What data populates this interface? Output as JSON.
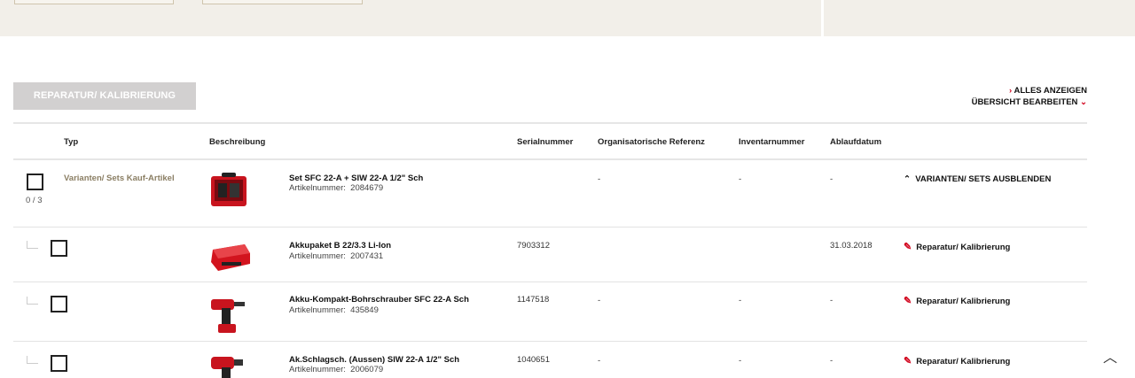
{
  "header": {
    "repair_button": "REPARATUR/ KALIBRIERUNG"
  },
  "links": {
    "show_all": "ALLES ANZEIGEN",
    "edit_overview": "ÜBERSICHT BEARBEITEN",
    "show_all_icon": "chevron-right-icon",
    "edit_icon": "chevron-down-icon"
  },
  "table": {
    "columns": [
      "Typ",
      "Beschreibung",
      "Serialnummer",
      "Organisatorische Referenz",
      "Inventarnummer",
      "Ablaufdatum"
    ],
    "set_row": {
      "type": "Varianten/ Sets Kauf-Artikel",
      "count": "0 / 3",
      "title": "Set SFC 22-A + SIW 22-A 1/2\" Sch",
      "article_label": "Artikelnummer:",
      "article_no": "2084679",
      "serial": "",
      "org_ref": "-",
      "inventory": "-",
      "expiry": "-",
      "action": "VARIANTEN/ SETS AUSBLENDEN"
    },
    "rows": [
      {
        "title": "Akkupaket B 22/3.3 Li-Ion",
        "article_label": "Artikelnummer:",
        "article_no": "2007431",
        "serial": "7903312",
        "org_ref": "",
        "inventory": "",
        "expiry": "31.03.2018",
        "action": "Reparatur/ Kalibrierung"
      },
      {
        "title": "Akku-Kompakt-Bohrschrauber SFC 22-A Sch",
        "article_label": "Artikelnummer:",
        "article_no": "435849",
        "serial": "1147518",
        "org_ref": "-",
        "inventory": "-",
        "expiry": "-",
        "action": "Reparatur/ Kalibrierung"
      },
      {
        "title": "Ak.Schlagsch. (Aussen) SIW 22-A 1/2\" Sch",
        "article_label": "Artikelnummer:",
        "article_no": "2006079",
        "serial": "1040651",
        "org_ref": "-",
        "inventory": "-",
        "expiry": "-",
        "action": "Reparatur/ Kalibrierung"
      }
    ]
  },
  "colors": {
    "accent": "#d2051e",
    "band": "#f2efe9",
    "button_disabled": "#d2d0d0",
    "type_text": "#8a7e63"
  },
  "icons": {
    "wrench": "wrench-icon",
    "collapse": "chevron-up-icon",
    "scroll_top": "chevron-up-icon"
  }
}
